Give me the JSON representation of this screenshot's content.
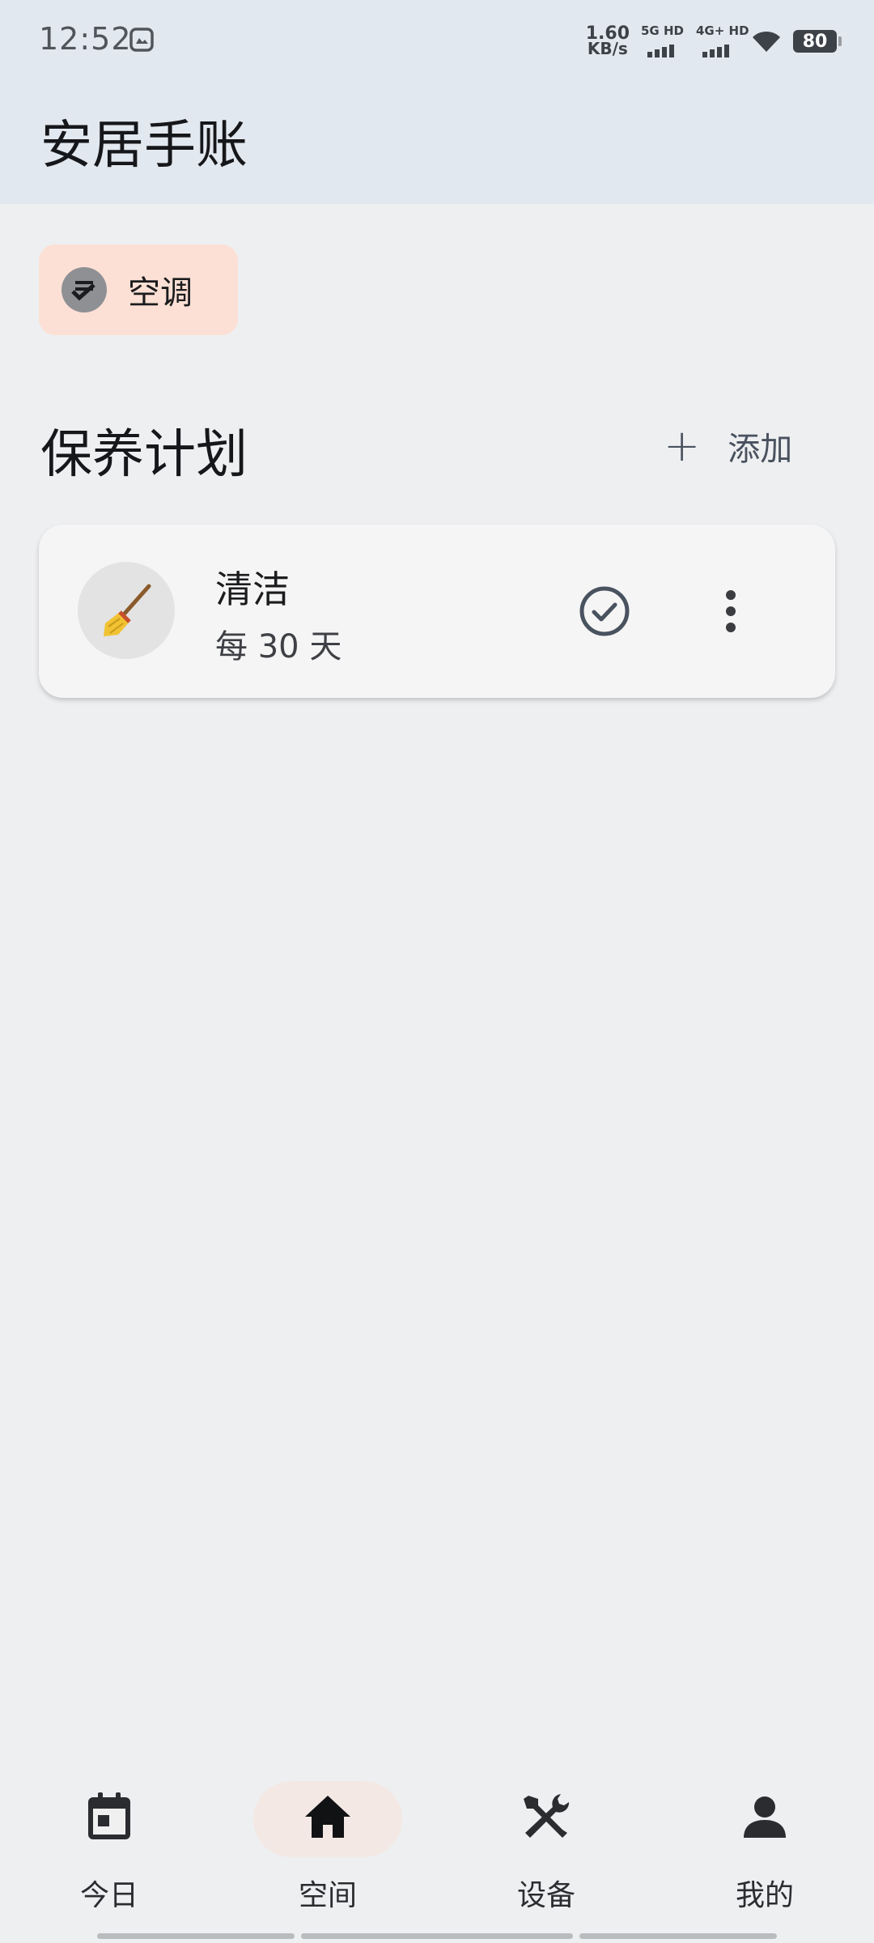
{
  "status_bar": {
    "time": "12:52",
    "net_speed_value": "1.60",
    "net_speed_unit": "KB/s",
    "signal_1_label": "5G HD",
    "signal_2_label": "4G+ HD",
    "battery": "80"
  },
  "header": {
    "title": "安居手账"
  },
  "space_chip": {
    "label": "空调",
    "icon": "checklist-icon"
  },
  "plans": {
    "title": "保养计划",
    "add_label": "添加",
    "items": [
      {
        "icon": "broom-icon",
        "name": "清洁",
        "frequency": "每 30 天"
      }
    ]
  },
  "bottom_nav": {
    "items": [
      {
        "label": "今日",
        "icon": "calendar-icon",
        "active": false
      },
      {
        "label": "空间",
        "icon": "home-icon",
        "active": true
      },
      {
        "label": "设备",
        "icon": "tools-icon",
        "active": false
      },
      {
        "label": "我的",
        "icon": "person-icon",
        "active": false
      }
    ]
  },
  "colors": {
    "top_bar": "#e2e8ef",
    "background": "#eeeff1",
    "chip": "#fde0d5",
    "nav_active": "#f3e8e3"
  }
}
